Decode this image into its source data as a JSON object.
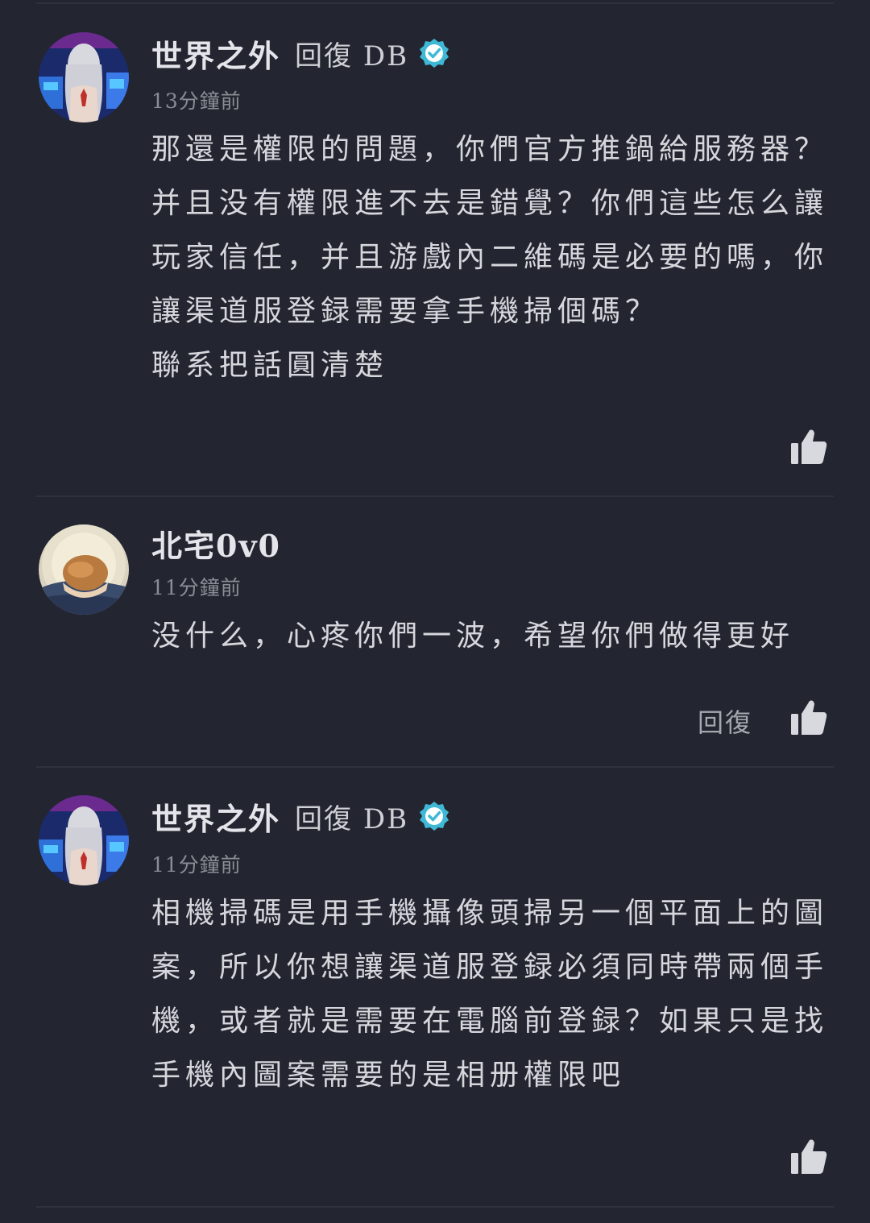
{
  "comments": [
    {
      "author": "世界之外",
      "reply_label": "回復",
      "reply_target": "DB",
      "time": "13分鐘前",
      "lines": [
        "那還是權限的問題，你們官方推鍋給服務器？",
        "并且没有權限進不去是錯覺？你們這些怎么讓",
        "玩家信任，并且游戲內二維碼是必要的嗎，你",
        "讓渠道服登録需要拿手機掃個碼？",
        "聯系把話圓清楚"
      ],
      "like_icon": "thumbs-up-icon"
    },
    {
      "author": "北宅0v0",
      "time": "11分鐘前",
      "lines": [
        "没什么，心疼你們一波，希望你們做得更好"
      ],
      "reply_button": "回復",
      "like_icon": "thumbs-up-icon"
    },
    {
      "author": "世界之外",
      "reply_label": "回復",
      "reply_target": "DB",
      "time": "11分鐘前",
      "lines": [
        "相機掃碼是用手機攝像頭掃另一個平面上的圖",
        "案，所以你想讓渠道服登録必須同時帶兩個手",
        "機，或者就是需要在電腦前登録？如果只是找",
        "手機內圖案需要的是相册權限吧"
      ],
      "like_icon": "thumbs-up-icon"
    }
  ],
  "colors": {
    "background": "#232530",
    "verified_badge": "#3fb8d6",
    "divider": "#2f313c"
  }
}
